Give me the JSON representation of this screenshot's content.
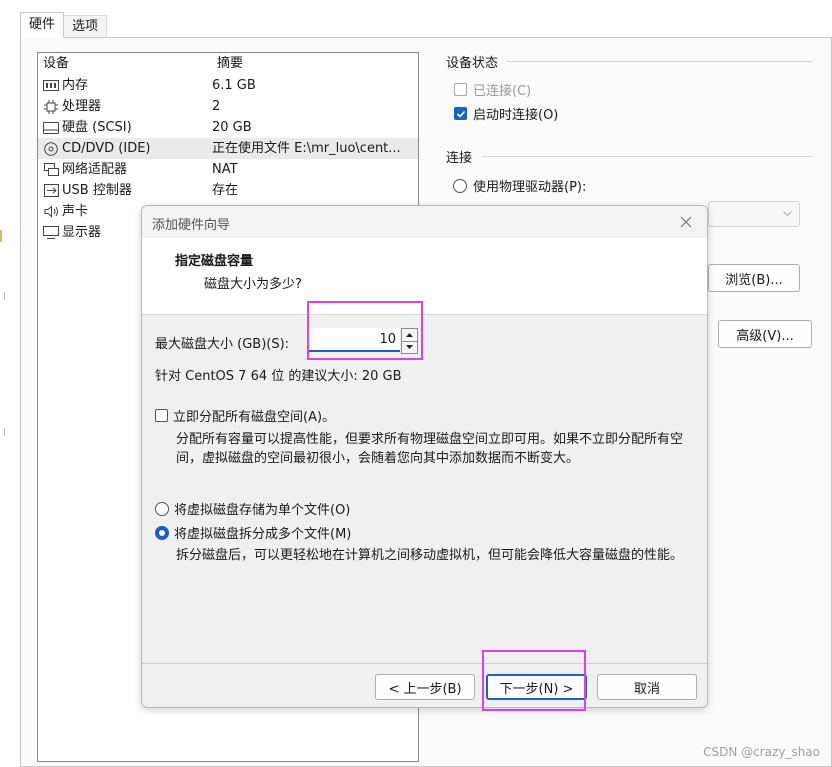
{
  "tabs": [
    {
      "label": "硬件",
      "active": true
    },
    {
      "label": "选项",
      "active": false
    }
  ],
  "device_list": {
    "header": {
      "device": "设备",
      "summary": "摘要"
    },
    "items": [
      {
        "icon": "memory-icon",
        "name": "内存",
        "summary": "6.1 GB"
      },
      {
        "icon": "processor-icon",
        "name": "处理器",
        "summary": "2"
      },
      {
        "icon": "hard-disk-icon",
        "name": "硬盘 (SCSI)",
        "summary": "20 GB"
      },
      {
        "icon": "cd-dvd-icon",
        "name": "CD/DVD (IDE)",
        "summary": "正在使用文件 E:\\mr_luo\\cent...",
        "selected": true
      },
      {
        "icon": "network-adapter-icon",
        "name": "网络适配器",
        "summary": "NAT"
      },
      {
        "icon": "usb-controller-icon",
        "name": "USB 控制器",
        "summary": "存在"
      },
      {
        "icon": "sound-card-icon",
        "name": "声卡",
        "summary": ""
      },
      {
        "icon": "display-icon",
        "name": "显示器",
        "summary": ""
      }
    ]
  },
  "device_status": {
    "title": "设备状态",
    "connected": {
      "label": "已连接(C)",
      "checked": false,
      "disabled": true
    },
    "connect_on_boot": {
      "label": "启动时连接(O)",
      "checked": true
    }
  },
  "connection": {
    "title": "连接",
    "physical_drive": {
      "label": "使用物理驱动器(P):",
      "checked": false
    },
    "browse_label": "浏览(B)...",
    "advanced_label": "高级(V)..."
  },
  "dialog": {
    "title": "添加硬件向导",
    "heading": "指定磁盘容量",
    "subheading": "磁盘大小为多少?",
    "max_size_label": "最大磁盘大小 (GB)(S):",
    "max_size_value": "10",
    "recommendation": "针对 CentOS 7 64 位 的建议大小: 20 GB",
    "allocate_now": {
      "label": "立即分配所有磁盘空间(A)。",
      "checked": false
    },
    "allocate_desc": "分配所有容量可以提高性能，但要求所有物理磁盘空间立即可用。如果不立即分配所有空间，虚拟磁盘的空间最初很小，会随着您向其中添加数据而不断变大。",
    "single_file": {
      "label": "将虚拟磁盘存储为单个文件(O)",
      "checked": false
    },
    "split_files": {
      "label": "将虚拟磁盘拆分成多个文件(M)",
      "checked": true
    },
    "split_desc": "拆分磁盘后，可以更轻松地在计算机之间移动虚拟机，但可能会降低大容量磁盘的性能。",
    "buttons": {
      "back": "< 上一步(B)",
      "next": "下一步(N) >",
      "cancel": "取消"
    }
  },
  "watermark": "CSDN @crazy_shao",
  "colors": {
    "accent": "#1f5fbf",
    "highlight": "#e040e0"
  }
}
